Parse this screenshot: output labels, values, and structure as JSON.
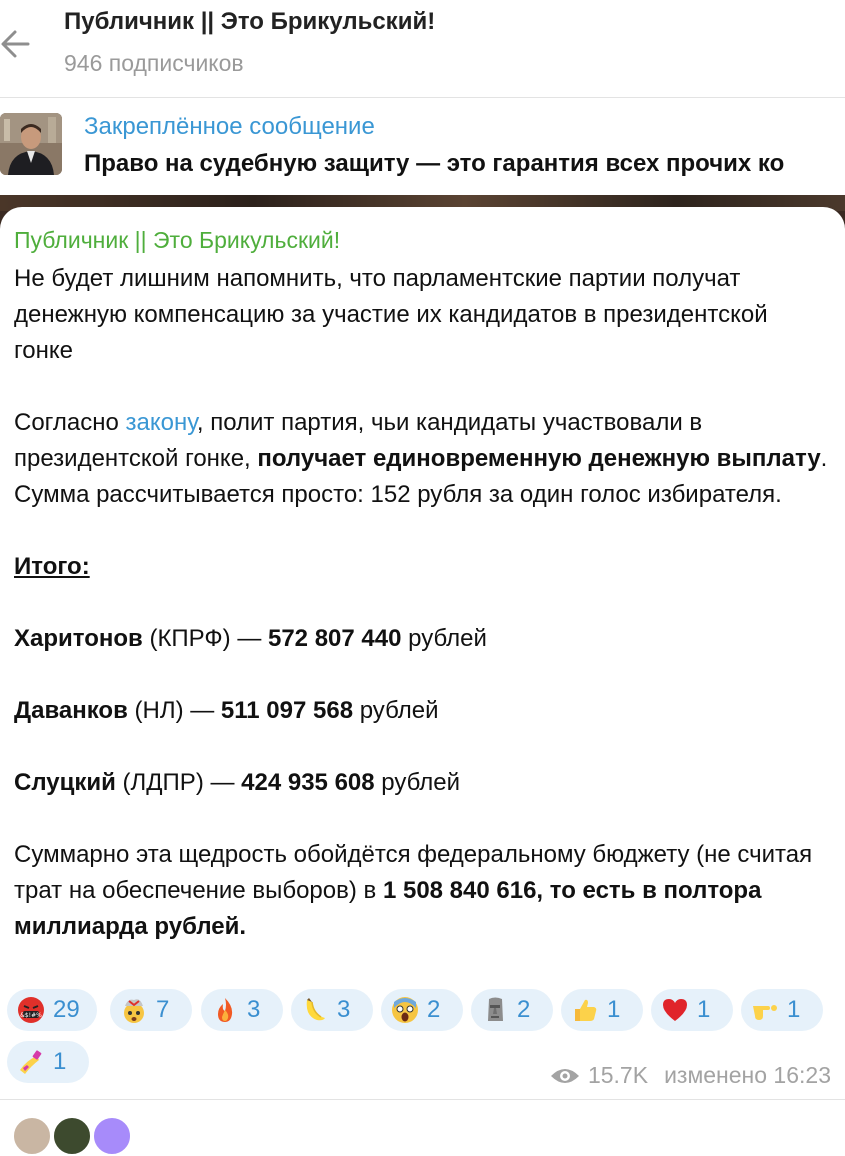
{
  "header": {
    "title": "Публичник || Это Брикульский!",
    "subscribers": "946 подписчиков"
  },
  "pinned": {
    "label": "Закреплённое сообщение",
    "text": "Право на судебную защиту — это гарантия всех прочих ко"
  },
  "message": {
    "author": "Публичник || Это Брикульский!",
    "p1": "Не будет лишним напомнить, что парламентские партии получат денежную компенсацию за участие их кандидатов в президентской гонке",
    "p2_a": "Согласно ",
    "p2_link": "закону",
    "p2_b": ", полит партия, чьи кандидаты участвовали в президентской гонке, ",
    "p2_bold": "получает единовременную денежную выплату",
    "p2_c": ". Сумма рассчитывается просто: 152 рубля за один голос избирателя.",
    "itogo": "Итого:",
    "rows": [
      {
        "name": "Харитонов",
        "party": " (КПРФ) — ",
        "amount": "572 807 440",
        "unit": " рублей"
      },
      {
        "name": "Даванков",
        "party": " (НЛ) — ",
        "amount": "511 097 568",
        "unit": " рублей"
      },
      {
        "name": "Слуцкий",
        "party": " (ЛДПР) — ",
        "amount": "424 935 608",
        "unit": " рублей"
      }
    ],
    "sum_a": "Суммарно эта щедрость обойдётся федеральному бюджету (не считая трат на обеспечение выборов) в ",
    "sum_bold": "1 508 840 616, то есть в полтора миллиарда рублей."
  },
  "reactions": [
    {
      "emoji": "swearing-face-icon",
      "count": "29"
    },
    {
      "emoji": "exploding-head-icon",
      "count": "7"
    },
    {
      "emoji": "fire-icon",
      "count": "3"
    },
    {
      "emoji": "banana-icon",
      "count": "3"
    },
    {
      "emoji": "screaming-face-icon",
      "count": "2"
    },
    {
      "emoji": "moai-icon",
      "count": "2"
    },
    {
      "emoji": "thumbs-up-icon",
      "count": "1"
    },
    {
      "emoji": "red-heart-icon",
      "count": "1"
    },
    {
      "emoji": "pointing-hand-icon",
      "count": "1"
    },
    {
      "emoji": "nail-polish-icon",
      "count": "1"
    }
  ],
  "meta": {
    "views": "15.7K",
    "edited": "изменено 16:23"
  },
  "colors": {
    "accent": "#3a97d4",
    "author": "#4fae3c",
    "reaction_bg": "#e6f1fa"
  }
}
